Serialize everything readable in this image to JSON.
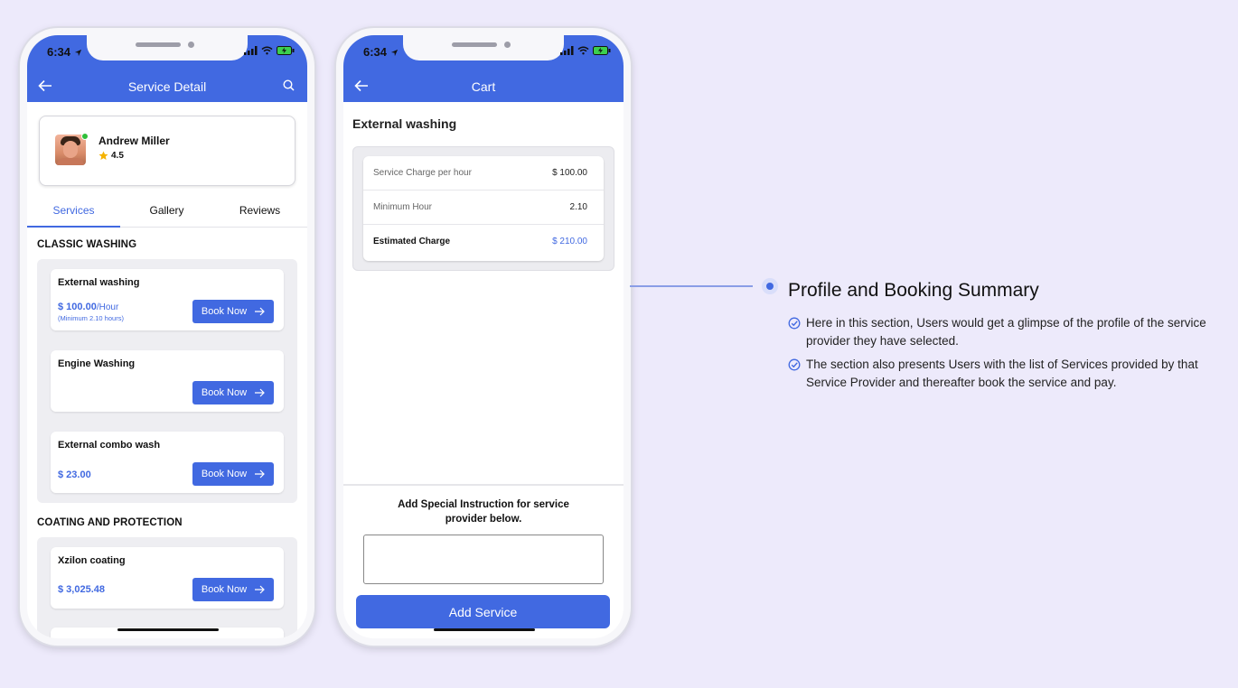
{
  "colors": {
    "primary": "#4169e1",
    "background": "#edeafb",
    "online": "#2fbf3a",
    "star": "#f5b301"
  },
  "status_bar": {
    "time": "6:34"
  },
  "service_detail": {
    "title": "Service Detail",
    "provider": {
      "name": "Andrew Miller",
      "rating": "4.5"
    },
    "tabs": [
      "Services",
      "Gallery",
      "Reviews"
    ],
    "sections": [
      {
        "heading": "CLASSIC WASHING",
        "services": [
          {
            "name": "External washing",
            "price": "$ 100.00",
            "unit": "/Hour",
            "note": "(Minimum 2.10 hours)",
            "button": "Book Now"
          },
          {
            "name": "Engine Washing",
            "button": "Book Now"
          },
          {
            "name": "External combo wash",
            "price": "$ 23.00",
            "button": "Book Now"
          }
        ]
      },
      {
        "heading": "COATING AND PROTECTION",
        "services": [
          {
            "name": "Xzilon coating",
            "price": "$ 3,025.48",
            "button": "Book Now"
          }
        ]
      }
    ]
  },
  "cart": {
    "title": "Cart",
    "service_name": "External washing",
    "rows": [
      {
        "label": "Service Charge per hour",
        "value": "$ 100.00"
      },
      {
        "label": "Minimum Hour",
        "value": "2.10"
      },
      {
        "label": "Estimated Charge",
        "value": "$ 210.00"
      }
    ],
    "instruction_label": "Add Special Instruction for service provider below.",
    "instruction_value": "",
    "add_button": "Add Service"
  },
  "annotation": {
    "title": "Profile and Booking Summary",
    "bullets": [
      "Here in this section, Users would get a glimpse of the profile of the service provider they have selected.",
      "The section also presents Users with the list of Services provided by that Service Provider and thereafter book the service and pay."
    ]
  }
}
